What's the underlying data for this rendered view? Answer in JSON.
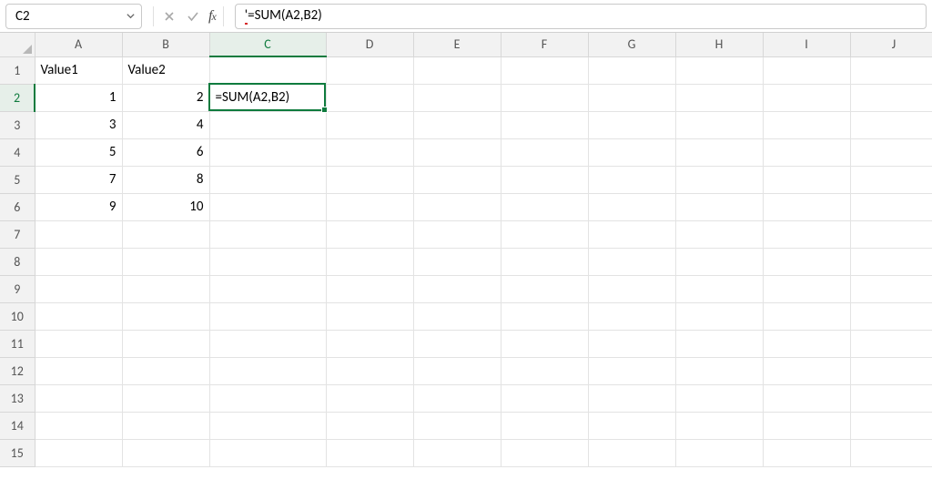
{
  "name_box": {
    "value": "C2"
  },
  "formula_bar": {
    "prefix": "'",
    "rest": "=SUM(A2,B2)"
  },
  "columns": [
    "A",
    "B",
    "C",
    "D",
    "E",
    "F",
    "G",
    "H",
    "I",
    "J"
  ],
  "rows": [
    "1",
    "2",
    "3",
    "4",
    "5",
    "6",
    "7",
    "8",
    "9",
    "10",
    "11",
    "12",
    "13",
    "14",
    "15"
  ],
  "active": {
    "col": "C",
    "row": "2"
  },
  "cells": {
    "A1": "Value1",
    "B1": "Value2",
    "A2": "1",
    "B2": "2",
    "C2": "=SUM(A2,B2)",
    "A3": "3",
    "B3": "4",
    "A4": "5",
    "B4": "6",
    "A5": "7",
    "B5": "8",
    "A6": "9",
    "B6": "10"
  },
  "colors": {
    "accent": "#0f7b3e"
  }
}
